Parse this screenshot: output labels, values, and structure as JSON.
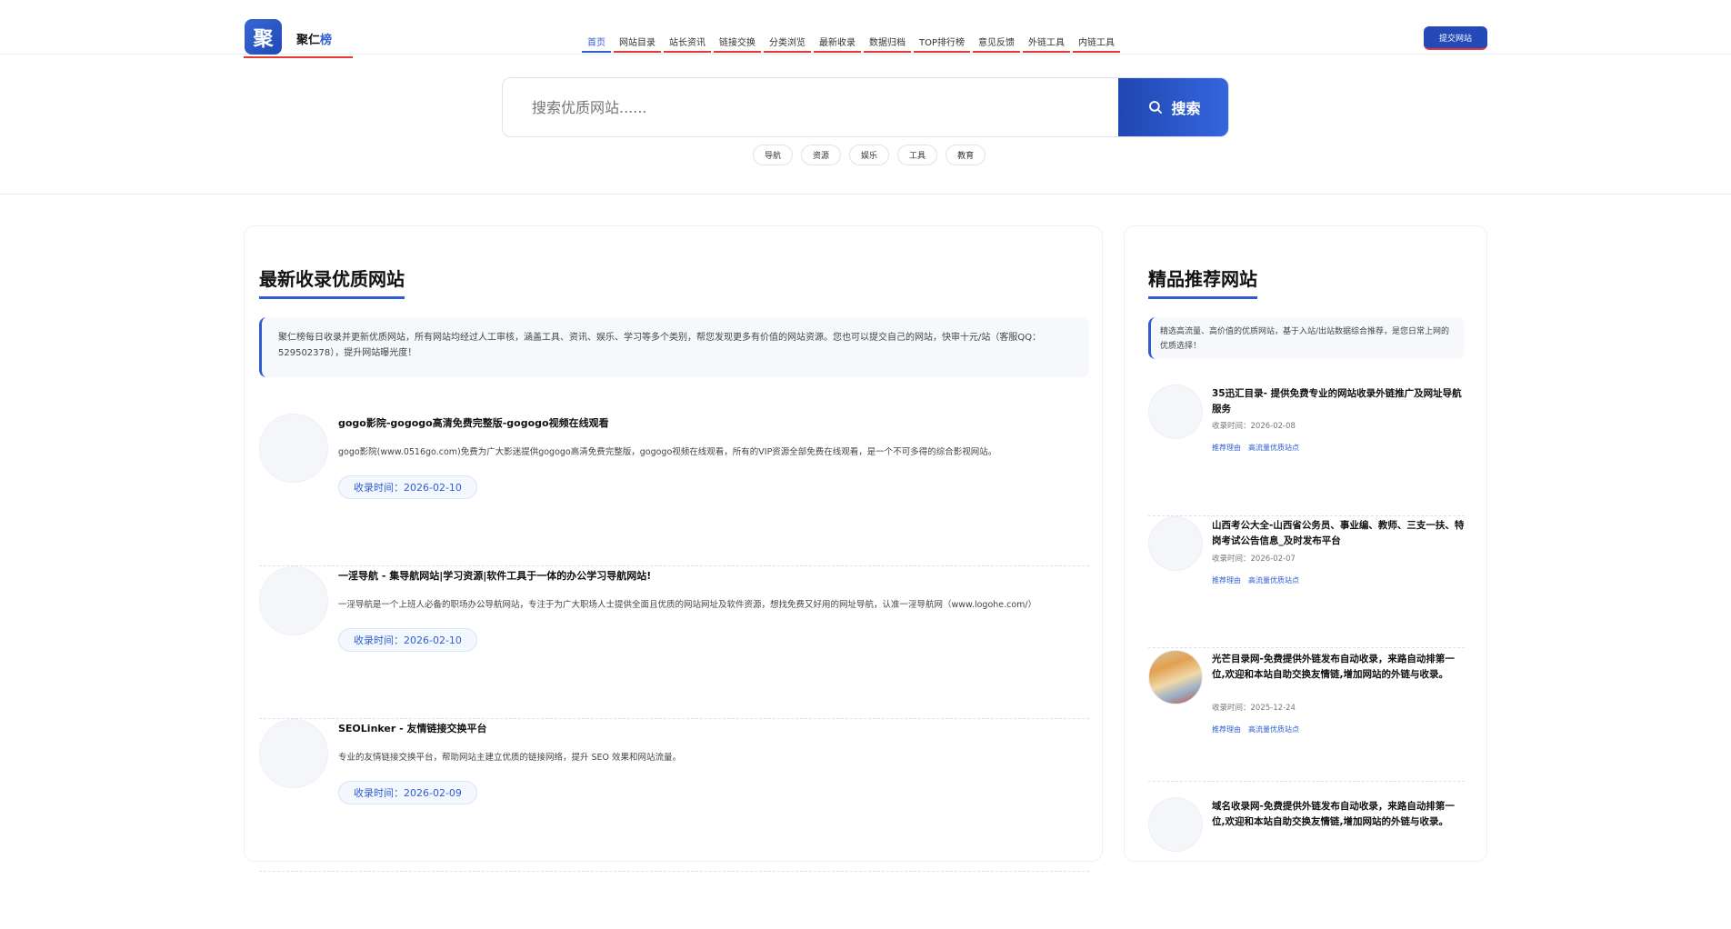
{
  "brand": {
    "logo_char": "聚",
    "name_part1": "聚仁",
    "name_part2": "榜"
  },
  "nav": {
    "items": [
      "首页",
      "网站目录",
      "站长资讯",
      "链接交换",
      "分类浏览",
      "最新收录",
      "数据归档",
      "TOP排行榜",
      "意见反馈",
      "外链工具",
      "内链工具"
    ]
  },
  "header": {
    "submit_label": "提交网站"
  },
  "search": {
    "placeholder": "搜索优质网站......",
    "button_label": "搜索"
  },
  "tags": [
    "导航",
    "资源",
    "娱乐",
    "工具",
    "教育"
  ],
  "main": {
    "title": "最新收录优质网站",
    "notice": "聚仁榜每日收录并更新优质网站，所有网站均经过人工审核，涵盖工具、资讯、娱乐、学习等多个类别，帮您发现更多有价值的网站资源。您也可以提交自己的网站，快审十元/站（客服QQ：529502378），提升网站曝光度！",
    "entries": [
      {
        "title": "gogo影院-gogogo高清免费完整版-gogogo视频在线观看",
        "desc": "gogo影院(www.0516go.com)免费为广大影迷提供gogogo高清免费完整版，gogogo视频在线观看，所有的VIP资源全部免费在线观看，是一个不可多得的综合影视网站。",
        "date": "收录时间：2026-02-10"
      },
      {
        "title": "一淫导航 - 集导航网站|学习资源|软件工具于一体的办公学习导航网站!",
        "desc": "一淫导航是一个上班人必备的职场办公导航网站，专注于为广大职场人士提供全面且优质的网站网址及软件资源，想找免费又好用的网址导航，认准一淫导航网（www.logohe.com/）",
        "date": "收录时间：2026-02-10"
      },
      {
        "title": "SEOLinker - 友情链接交换平台",
        "desc": "专业的友情链接交换平台，帮助网站主建立优质的链接网络，提升 SEO 效果和网站流量。",
        "date": "收录时间：2026-02-09"
      }
    ]
  },
  "side": {
    "title": "精品推荐网站",
    "notice": "精选高流量、高价值的优质网站，基于入站/出站数据综合推荐，是您日常上网的优质选择！",
    "items": [
      {
        "title": "35迅汇目录- 提供免费专业的网站收录外链推广及网址导航服务",
        "date": "收录时间：2026-02-08",
        "tag1": "推荐理由",
        "tag2": "高流量优质站点"
      },
      {
        "title": "山西考公大全-山西省公务员、事业编、教师、三支一扶、特岗考试公告信息_及时发布平台",
        "date": "收录时间：2026-02-07",
        "tag1": "推荐理由",
        "tag2": "高流量优质站点"
      },
      {
        "title": "光芒目录网-免费提供外链发布自动收录，来路自动排第一位,欢迎和本站自助交换友情链,增加网站的外链与收录。",
        "date": "收录时间：2025-12-24",
        "tag1": "推荐理由",
        "tag2": "高流量优质站点"
      },
      {
        "title": "域名收录网-免费提供外链发布自动收录，来路自动排第一位,欢迎和本站自助交换友情链,增加网站的外链与收录。",
        "date": "",
        "tag1": "",
        "tag2": ""
      }
    ]
  },
  "colors": {
    "accent": "#2f5dd1",
    "underline_red": "#e53935"
  }
}
